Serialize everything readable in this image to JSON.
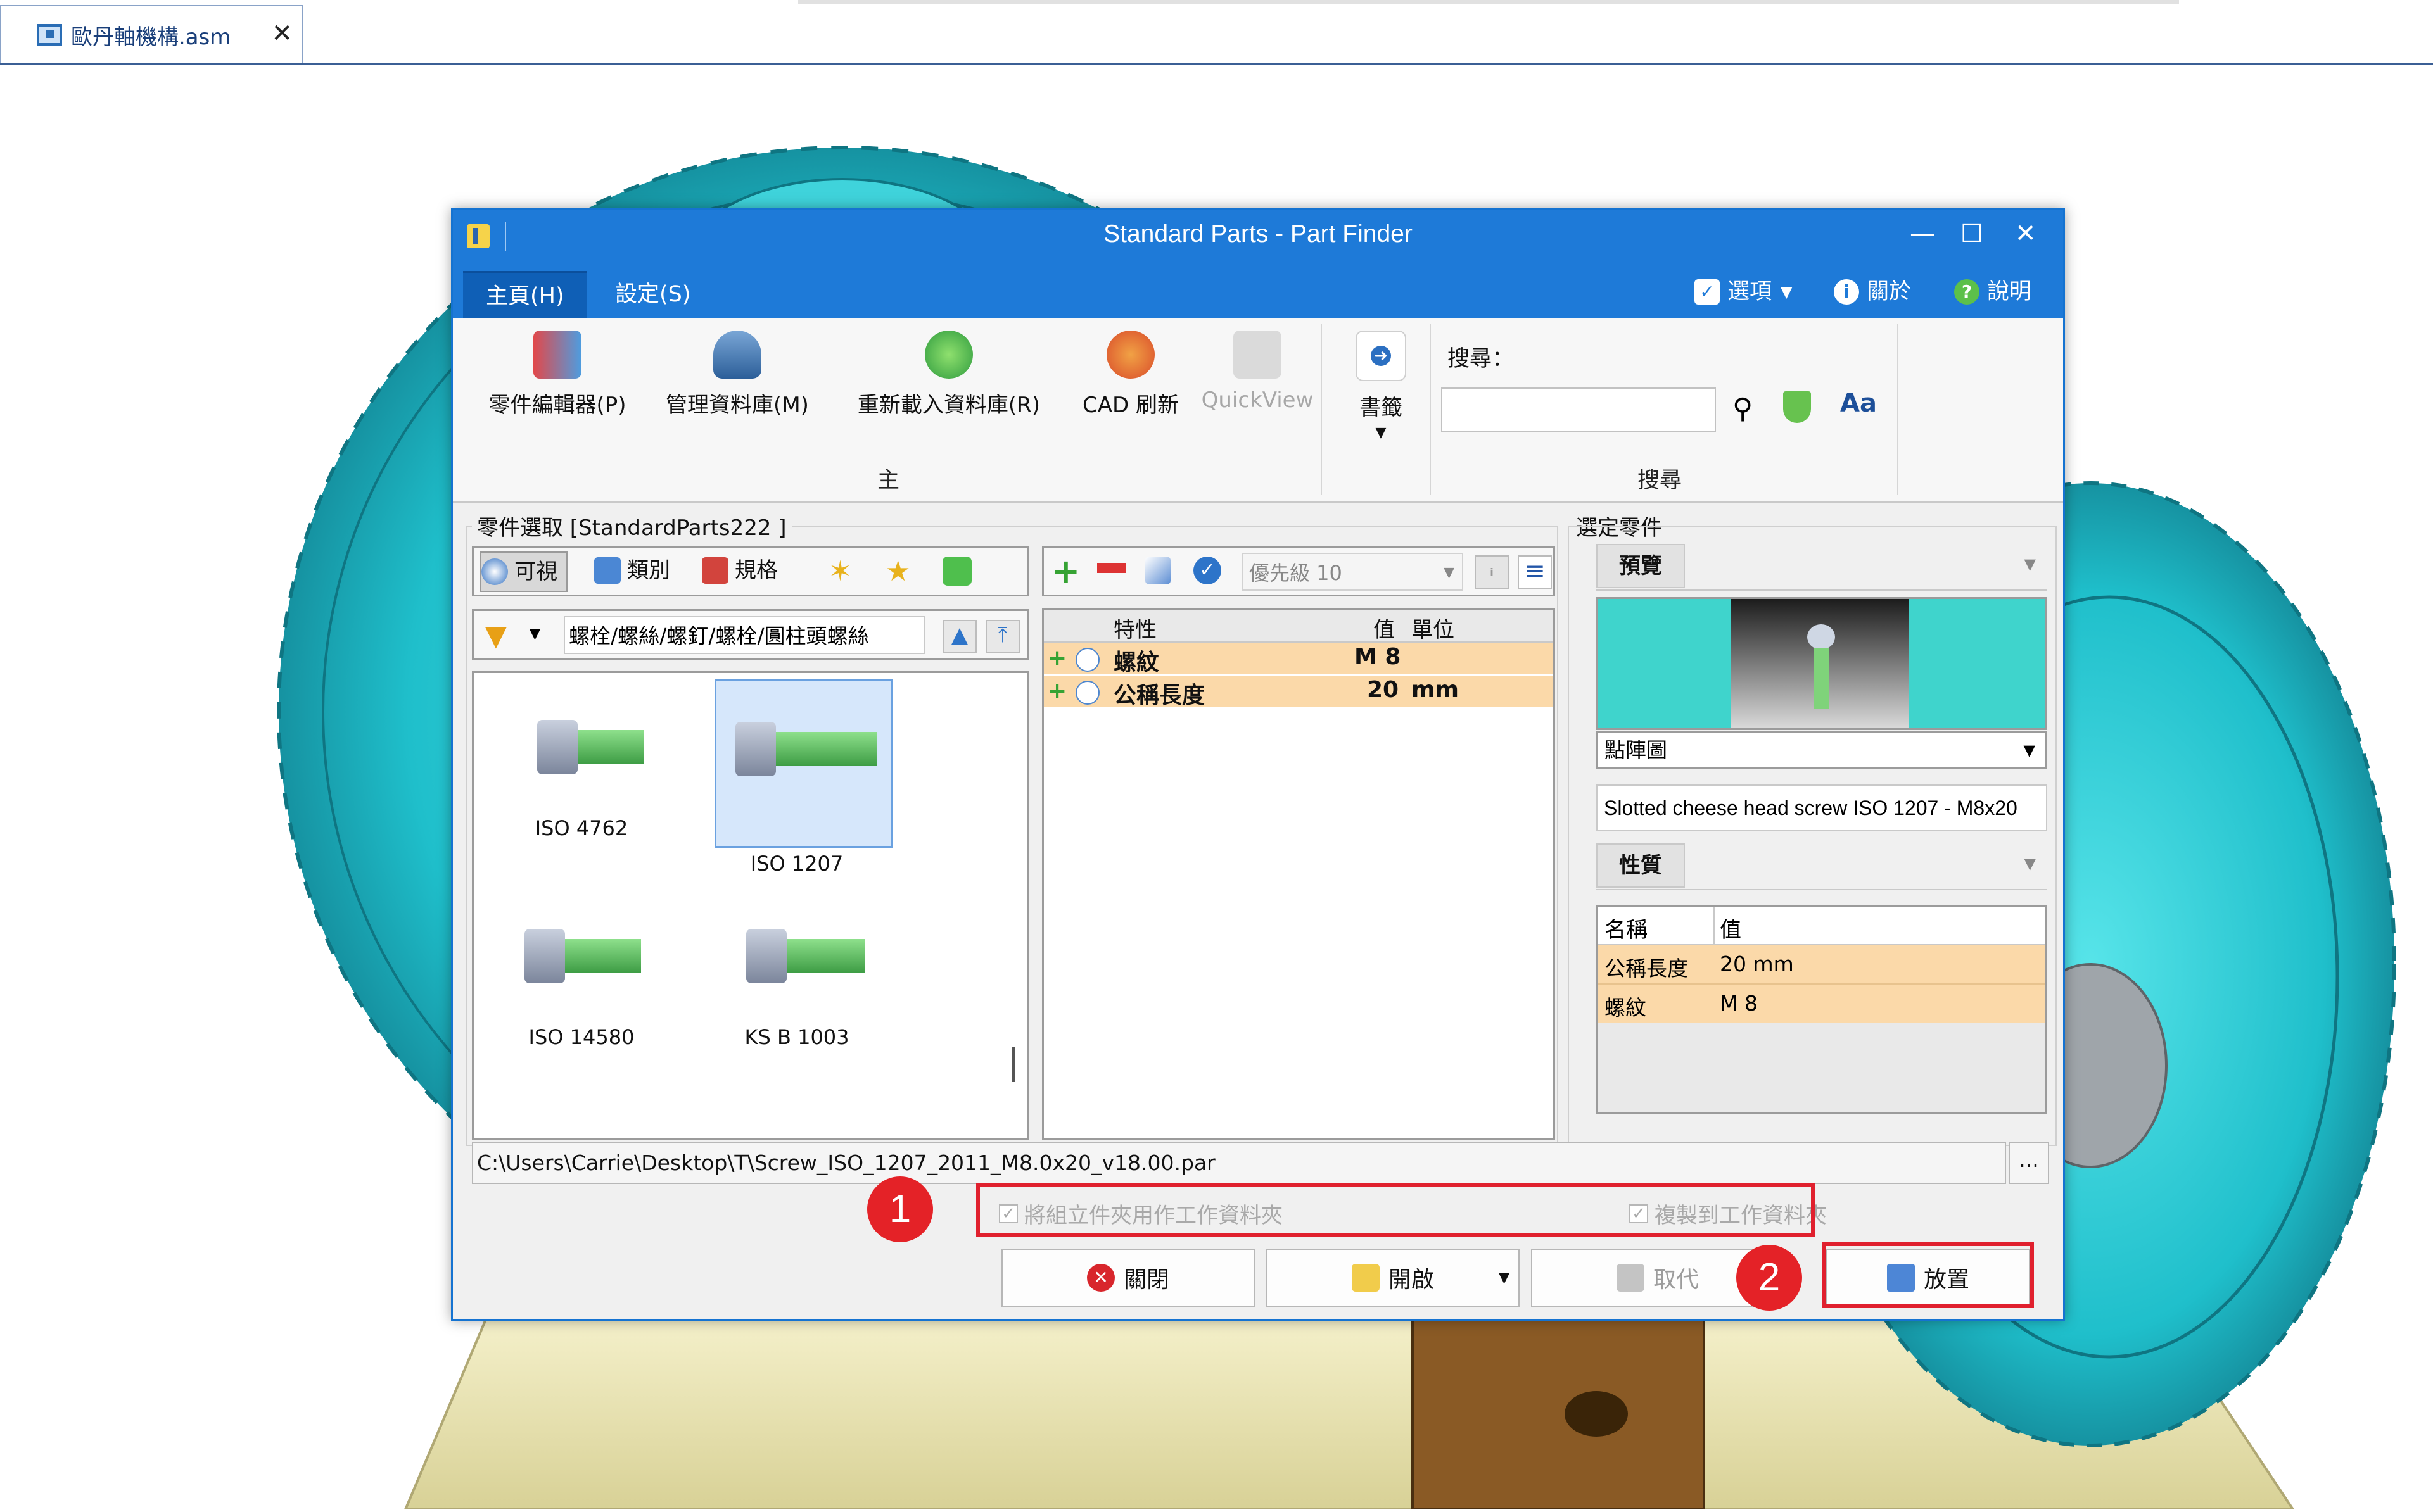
{
  "document_tab": {
    "title": "歐丹軸機構.asm",
    "close": "✕"
  },
  "dialog": {
    "title": "Standard Parts - Part Finder",
    "window_buttons": {
      "minimize": "—",
      "maximize": "☐",
      "close": "✕"
    },
    "menu_tabs": [
      "主頁(H)",
      "設定(S)"
    ],
    "right_menu": {
      "options": "選項",
      "about": "關於",
      "help": "說明"
    },
    "ribbon": {
      "buttons": [
        "零件編輯器(P)",
        "管理資料庫(M)",
        "重新載入資料庫(R)",
        "CAD 刷新",
        "QuickView"
      ],
      "group_main": "主",
      "bookmark": "書籤",
      "search_label": "搜尋：",
      "search_value": "",
      "group_search": "搜尋"
    },
    "part_select": {
      "title": "零件選取 [StandardParts222 ]",
      "view_tabs": [
        "可視",
        "類別",
        "規格"
      ],
      "path": "螺栓/螺絲/螺釘/螺栓/圓柱頭螺絲",
      "thumbnails": [
        "ISO 4762",
        "ISO 1207",
        "ISO 14580",
        "KS B 1003"
      ],
      "selected": "ISO 1207"
    },
    "properties_grid": {
      "priority": "優先級 10",
      "headers": {
        "property": "特性",
        "value": "值",
        "unit": "單位"
      },
      "rows": [
        {
          "name": "螺紋",
          "value": "M 8",
          "unit": ""
        },
        {
          "name": "公稱長度",
          "value": "20",
          "unit": "mm"
        }
      ]
    },
    "selected_part": {
      "title": "選定零件",
      "preview_tab": "預覽",
      "preview_mode": "點陣圖",
      "description": "Slotted cheese head screw ISO 1207 - M8x20",
      "props_tab": "性質",
      "props_headers": {
        "name": "名稱",
        "value": "值"
      },
      "props_rows": [
        {
          "name": "公稱長度",
          "value": "20 mm"
        },
        {
          "name": "螺紋",
          "value": "M 8"
        }
      ]
    },
    "file_path": "C:\\Users\\Carrie\\Desktop\\T\\Screw_ISO_1207_2011_M8.0x20_v18.00.par",
    "browse": "...",
    "checkboxes": {
      "use_assembly_folder": "將組立件夾用作工作資料夾",
      "copy_to_folder": "複製到工作資料夾"
    },
    "buttons": {
      "close": "關閉",
      "open": "開啟",
      "replace": "取代",
      "place": "放置"
    },
    "callouts": [
      "1",
      "2"
    ]
  },
  "colors": {
    "title_blue": "#1e7ad8",
    "gear_cyan": "#22c7cf",
    "highlight": "#fbd9a9",
    "callout_red": "#e42227"
  }
}
